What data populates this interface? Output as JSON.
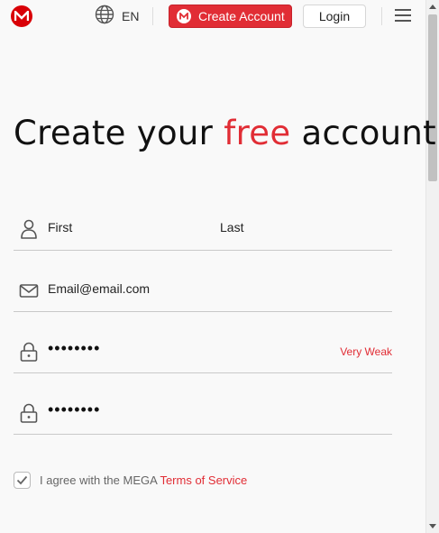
{
  "header": {
    "language": "EN",
    "create_account_label": "Create Account",
    "login_label": "Login"
  },
  "headline": {
    "part1": "Create your ",
    "accent": "free",
    "part2": " account"
  },
  "form": {
    "first_name": "First",
    "last_name": "Last",
    "email": "Email@email.com",
    "password_masked": "••••••••",
    "password_strength": "Very Weak",
    "confirm_masked": "••••••••"
  },
  "terms": {
    "prefix": "I agree with the MEGA ",
    "link": "Terms of Service",
    "checked": true
  },
  "colors": {
    "brand": "#e12d35",
    "logo": "#d90007"
  },
  "icons": [
    "mega-logo-icon",
    "globe-icon",
    "menu-icon",
    "user-icon",
    "email-icon",
    "lock-icon",
    "check-icon"
  ]
}
